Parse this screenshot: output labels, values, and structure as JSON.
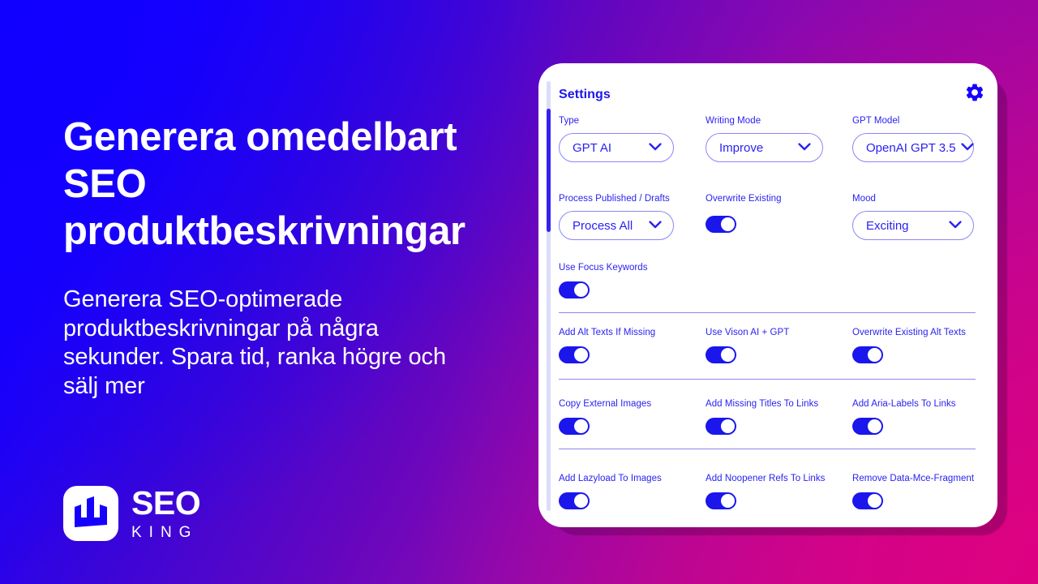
{
  "background": {
    "gradient_from": "#1500FF",
    "gradient_mid": "#8B09AF",
    "gradient_to": "#D4057F"
  },
  "hero": {
    "headline": "Generera omedelbart SEO produktbeskrivningar",
    "subheadline": "Generera SEO-optimerade produktbeskrivningar på några sekunder. Spara tid, ranka högre och sälj mer"
  },
  "logo": {
    "mark_icon": "bar-chart-crown-icon",
    "primary": "SEO",
    "secondary": "KING",
    "mark_color": "#1500FF"
  },
  "settings_panel": {
    "title": "Settings",
    "gear_icon": "gear-icon",
    "accent_color": "#1A16EC",
    "border_color": "#8D86F6",
    "scrollbar": {
      "track_color": "#DCDCFB",
      "thumb_color": "#3421F0"
    },
    "fields": [
      {
        "label": "Type",
        "type": "select",
        "value": "GPT AI"
      },
      {
        "label": "Writing Mode",
        "type": "select",
        "value": "Improve"
      },
      {
        "label": "GPT Model",
        "type": "select",
        "value": "OpenAI GPT 3.5"
      },
      {
        "label": "Process Published / Drafts",
        "type": "select",
        "value": "Process All"
      },
      {
        "label": "Overwrite Existing",
        "type": "toggle",
        "value": "on"
      },
      {
        "label": "Mood",
        "type": "select",
        "value": "Exciting"
      },
      {
        "label": "Use Focus Keywords",
        "type": "toggle",
        "value": "on"
      },
      {
        "label": "Add Alt Texts If Missing",
        "type": "toggle",
        "value": "on"
      },
      {
        "label": "Use Vison AI + GPT",
        "type": "toggle",
        "value": "on"
      },
      {
        "label": "Overwrite Existing Alt Texts",
        "type": "toggle",
        "value": "on"
      },
      {
        "label": "Copy External Images",
        "type": "toggle",
        "value": "on"
      },
      {
        "label": "Add Missing Titles To Links",
        "type": "toggle",
        "value": "on"
      },
      {
        "label": "Add Aria-Labels To Links",
        "type": "toggle",
        "value": "on"
      },
      {
        "label": "Add Lazyload To Images",
        "type": "toggle",
        "value": "on"
      },
      {
        "label": "Add Noopener Refs To Links",
        "type": "toggle",
        "value": "on"
      },
      {
        "label": "Remove Data-Mce-Fragment",
        "type": "toggle",
        "value": "on"
      }
    ]
  }
}
